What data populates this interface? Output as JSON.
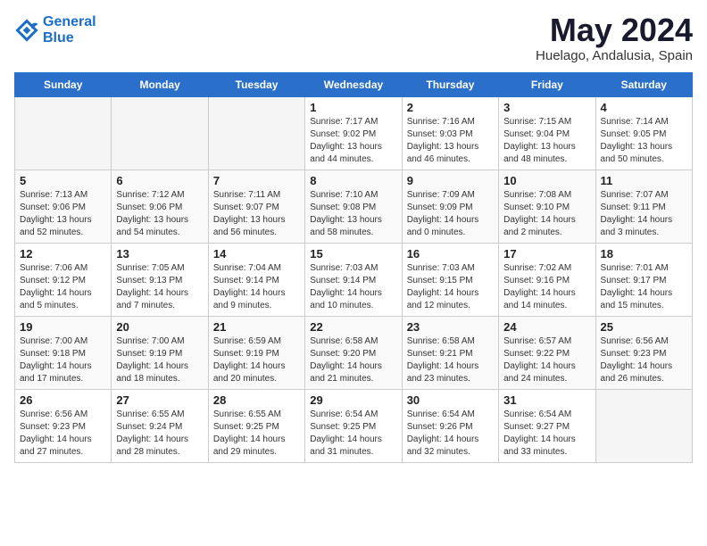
{
  "header": {
    "logo_line1": "General",
    "logo_line2": "Blue",
    "title": "May 2024",
    "subtitle": "Huelago, Andalusia, Spain"
  },
  "days_of_week": [
    "Sunday",
    "Monday",
    "Tuesday",
    "Wednesday",
    "Thursday",
    "Friday",
    "Saturday"
  ],
  "weeks": [
    [
      {
        "day": "",
        "empty": true
      },
      {
        "day": "",
        "empty": true
      },
      {
        "day": "",
        "empty": true
      },
      {
        "day": "1",
        "sunrise": "7:17 AM",
        "sunset": "9:02 PM",
        "daylight": "13 hours and 44 minutes."
      },
      {
        "day": "2",
        "sunrise": "7:16 AM",
        "sunset": "9:03 PM",
        "daylight": "13 hours and 46 minutes."
      },
      {
        "day": "3",
        "sunrise": "7:15 AM",
        "sunset": "9:04 PM",
        "daylight": "13 hours and 48 minutes."
      },
      {
        "day": "4",
        "sunrise": "7:14 AM",
        "sunset": "9:05 PM",
        "daylight": "13 hours and 50 minutes."
      }
    ],
    [
      {
        "day": "5",
        "sunrise": "7:13 AM",
        "sunset": "9:06 PM",
        "daylight": "13 hours and 52 minutes."
      },
      {
        "day": "6",
        "sunrise": "7:12 AM",
        "sunset": "9:06 PM",
        "daylight": "13 hours and 54 minutes."
      },
      {
        "day": "7",
        "sunrise": "7:11 AM",
        "sunset": "9:07 PM",
        "daylight": "13 hours and 56 minutes."
      },
      {
        "day": "8",
        "sunrise": "7:10 AM",
        "sunset": "9:08 PM",
        "daylight": "13 hours and 58 minutes."
      },
      {
        "day": "9",
        "sunrise": "7:09 AM",
        "sunset": "9:09 PM",
        "daylight": "14 hours and 0 minutes."
      },
      {
        "day": "10",
        "sunrise": "7:08 AM",
        "sunset": "9:10 PM",
        "daylight": "14 hours and 2 minutes."
      },
      {
        "day": "11",
        "sunrise": "7:07 AM",
        "sunset": "9:11 PM",
        "daylight": "14 hours and 3 minutes."
      }
    ],
    [
      {
        "day": "12",
        "sunrise": "7:06 AM",
        "sunset": "9:12 PM",
        "daylight": "14 hours and 5 minutes."
      },
      {
        "day": "13",
        "sunrise": "7:05 AM",
        "sunset": "9:13 PM",
        "daylight": "14 hours and 7 minutes."
      },
      {
        "day": "14",
        "sunrise": "7:04 AM",
        "sunset": "9:14 PM",
        "daylight": "14 hours and 9 minutes."
      },
      {
        "day": "15",
        "sunrise": "7:03 AM",
        "sunset": "9:14 PM",
        "daylight": "14 hours and 10 minutes."
      },
      {
        "day": "16",
        "sunrise": "7:03 AM",
        "sunset": "9:15 PM",
        "daylight": "14 hours and 12 minutes."
      },
      {
        "day": "17",
        "sunrise": "7:02 AM",
        "sunset": "9:16 PM",
        "daylight": "14 hours and 14 minutes."
      },
      {
        "day": "18",
        "sunrise": "7:01 AM",
        "sunset": "9:17 PM",
        "daylight": "14 hours and 15 minutes."
      }
    ],
    [
      {
        "day": "19",
        "sunrise": "7:00 AM",
        "sunset": "9:18 PM",
        "daylight": "14 hours and 17 minutes."
      },
      {
        "day": "20",
        "sunrise": "7:00 AM",
        "sunset": "9:19 PM",
        "daylight": "14 hours and 18 minutes."
      },
      {
        "day": "21",
        "sunrise": "6:59 AM",
        "sunset": "9:19 PM",
        "daylight": "14 hours and 20 minutes."
      },
      {
        "day": "22",
        "sunrise": "6:58 AM",
        "sunset": "9:20 PM",
        "daylight": "14 hours and 21 minutes."
      },
      {
        "day": "23",
        "sunrise": "6:58 AM",
        "sunset": "9:21 PM",
        "daylight": "14 hours and 23 minutes."
      },
      {
        "day": "24",
        "sunrise": "6:57 AM",
        "sunset": "9:22 PM",
        "daylight": "14 hours and 24 minutes."
      },
      {
        "day": "25",
        "sunrise": "6:56 AM",
        "sunset": "9:23 PM",
        "daylight": "14 hours and 26 minutes."
      }
    ],
    [
      {
        "day": "26",
        "sunrise": "6:56 AM",
        "sunset": "9:23 PM",
        "daylight": "14 hours and 27 minutes."
      },
      {
        "day": "27",
        "sunrise": "6:55 AM",
        "sunset": "9:24 PM",
        "daylight": "14 hours and 28 minutes."
      },
      {
        "day": "28",
        "sunrise": "6:55 AM",
        "sunset": "9:25 PM",
        "daylight": "14 hours and 29 minutes."
      },
      {
        "day": "29",
        "sunrise": "6:54 AM",
        "sunset": "9:25 PM",
        "daylight": "14 hours and 31 minutes."
      },
      {
        "day": "30",
        "sunrise": "6:54 AM",
        "sunset": "9:26 PM",
        "daylight": "14 hours and 32 minutes."
      },
      {
        "day": "31",
        "sunrise": "6:54 AM",
        "sunset": "9:27 PM",
        "daylight": "14 hours and 33 minutes."
      },
      {
        "day": "",
        "empty": true
      }
    ]
  ],
  "labels": {
    "sunrise": "Sunrise:",
    "sunset": "Sunset:",
    "daylight": "Daylight:"
  },
  "colors": {
    "header_bg": "#2a6fc9",
    "header_text": "#ffffff"
  }
}
